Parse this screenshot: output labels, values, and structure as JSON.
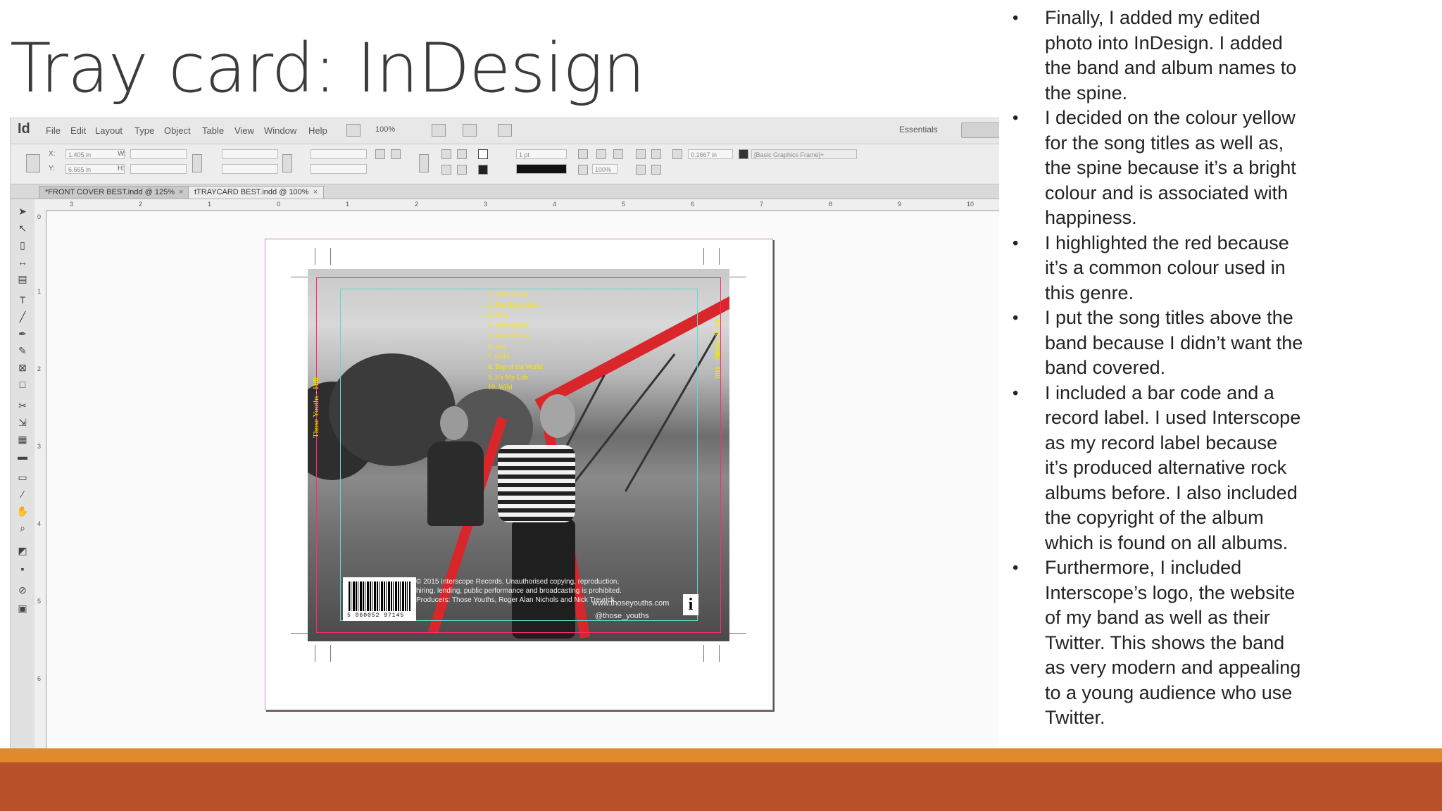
{
  "slide": {
    "title": "Tray card: InDesign",
    "bullets": [
      "Finally, I added my edited photo into InDesign. I added the band and album names to the spine.",
      "I decided on the colour yellow for the song titles as well as, the spine because it’s a bright colour and is associated with happiness.",
      "I highlighted the red because it’s a common colour used in this genre.",
      "I put the song titles above the band because I didn’t want the band covered.",
      "I included a bar code and a record label. I used Interscope as my record label because it’s produced alternative rock albums before. I also included the copyright of the album which is found on all albums.",
      "Furthermore, I included Interscope’s logo, the website of my band as well as their Twitter. This shows the band as very modern and appealing to a young audience who use Twitter."
    ],
    "bullet_glyph": "•"
  },
  "app": {
    "logo": "Id",
    "menu": [
      "File",
      "Edit",
      "Layout",
      "Type",
      "Object",
      "Table",
      "View",
      "Window",
      "Help"
    ],
    "zoom": "100%",
    "workspace": "Essentials",
    "control": {
      "x_label": "X:",
      "x_value": "1.405 in",
      "y_label": "Y:",
      "y_value": "6.665 in",
      "w_label": "W:",
      "h_label": "H:",
      "stroke_weight": "1 pt",
      "scale_pct": "100%",
      "offset_value": "0.1667 in",
      "object_style": "[Basic Graphics Frame]+"
    },
    "tabs": [
      {
        "label": "*FRONT COVER BEST.indd @ 125%",
        "close": "×"
      },
      {
        "label": "tTRAYCARD BEST.indd @ 100%",
        "close": "×"
      }
    ],
    "ruler_top": [
      "3",
      "2",
      "1",
      "0",
      "1",
      "2",
      "3",
      "4",
      "5",
      "6",
      "7",
      "8",
      "9",
      "10"
    ],
    "ruler_left": [
      "0",
      "1",
      "2",
      "3",
      "4",
      "5",
      "6"
    ]
  },
  "traycard": {
    "songs": [
      "1. Hello Good",
      "2. Run Baby Run",
      "3. Next",
      "4. Apocalyptic",
      "5. How We Go",
      "6. Fun",
      "7. Gold",
      "8. Top of the World",
      "9. It's My Life",
      "10. Wild"
    ],
    "spine_left": "Those Youths - Hill",
    "spine_right": "Those Youths - Hill",
    "copyright": "© 2015 Interscope Records. Unauthorised copying, reproduction, hiring, lending, public performance and broadcasting is prohibited.",
    "producers": "Producers: Those Youths, Roger Alan Nichols and Nick Trevrick",
    "barcode_digits": "5 060052 97145",
    "website": "www.thoseyouths.com",
    "twitter": "@those_youths",
    "label_logo": "i"
  },
  "colors": {
    "title": "#3b3b3b",
    "song_yellow": "#ffe600",
    "footer_rust": "#b9512a",
    "footer_orange": "#e08a2c"
  }
}
